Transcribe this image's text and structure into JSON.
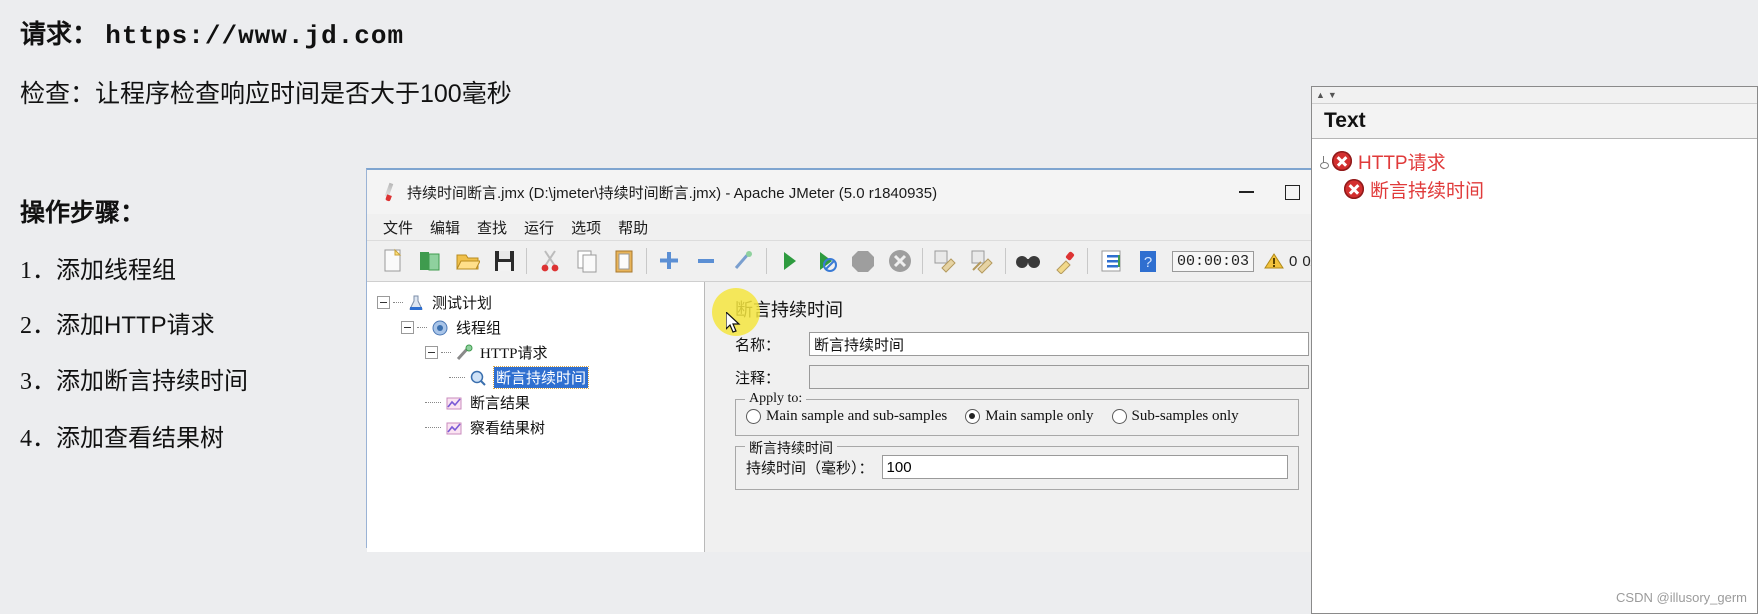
{
  "slide": {
    "request_label": "请求：",
    "request_url": "https://www.jd.com",
    "check_line": "检查：让程序检查响应时间是否大于100毫秒",
    "steps_title": "操作步骤：",
    "steps": [
      {
        "num": "1．",
        "text": "添加线程组"
      },
      {
        "num": "2．",
        "text": "添加HTTP请求"
      },
      {
        "num": "3．",
        "text": "添加断言持续时间"
      },
      {
        "num": "4．",
        "text": "添加查看结果树"
      }
    ]
  },
  "jmeter": {
    "title": "持续时间断言.jmx (D:\\jmeter\\持续时间断言.jmx) - Apache JMeter (5.0 r1840935)",
    "window_buttons": {
      "minimize": "—",
      "maximize": "□"
    },
    "menu": [
      "文件",
      "编辑",
      "查找",
      "运行",
      "选项",
      "帮助"
    ],
    "toolbar_icons": [
      "new-file-icon",
      "open-template-icon",
      "open-folder-icon",
      "save-icon",
      "cut-icon",
      "copy-icon",
      "paste-icon",
      "expand-all-icon",
      "collapse-all-icon",
      "toggle-icon",
      "start-icon",
      "start-no-pauses-icon",
      "stop-icon",
      "shutdown-icon",
      "clear-icon",
      "clear-all-icon",
      "search-icon",
      "reset-search-icon",
      "function-helper-icon",
      "help-icon"
    ],
    "timer": "00:00:03",
    "warn_icon": "warning-triangle-icon",
    "warn_count": "0",
    "thread_counter": "0/",
    "tree": [
      {
        "label": "测试计划",
        "icon": "test-plan-icon",
        "depth": 0,
        "expanded": true,
        "selected": false
      },
      {
        "label": "线程组",
        "icon": "thread-group-icon",
        "depth": 1,
        "expanded": true,
        "selected": false
      },
      {
        "label": "HTTP请求",
        "icon": "http-request-icon",
        "depth": 2,
        "expanded": true,
        "selected": false,
        "serif_prefix": true
      },
      {
        "label": "断言持续时间",
        "icon": "duration-assertion-icon",
        "depth": 3,
        "expanded": false,
        "selected": true
      },
      {
        "label": "断言结果",
        "icon": "assertion-results-icon",
        "depth": 2,
        "expanded": false,
        "selected": false
      },
      {
        "label": "察看结果树",
        "icon": "view-results-tree-icon",
        "depth": 2,
        "expanded": false,
        "selected": false
      }
    ],
    "panel": {
      "title": "断言持续时间",
      "name_label": "名称：",
      "name_value": "断言持续时间",
      "comment_label": "注释：",
      "comment_value": "",
      "apply_to_legend": "Apply to:",
      "apply_to_options": [
        {
          "label": "Main sample and sub-samples",
          "selected": false
        },
        {
          "label": "Main sample only",
          "selected": true
        },
        {
          "label": "Sub-samples only",
          "selected": false
        }
      ],
      "duration_legend": "断言持续时间",
      "duration_label": "持续时间（毫秒）：",
      "duration_value": "100"
    }
  },
  "text_panel": {
    "header": "Text",
    "items": [
      {
        "label": "HTTP请求",
        "icon": "error-icon",
        "depth": 0
      },
      {
        "label": "断言持续时间",
        "icon": "error-icon",
        "depth": 1
      }
    ]
  },
  "watermark": "CSDN @illusory_germ",
  "colors": {
    "selection_blue": "#2f6fd0",
    "error_red": "#d32f2f",
    "label_red": "#e03a3a",
    "highlight_yellow": "#f5e53f",
    "page_bg": "#ecedef"
  }
}
